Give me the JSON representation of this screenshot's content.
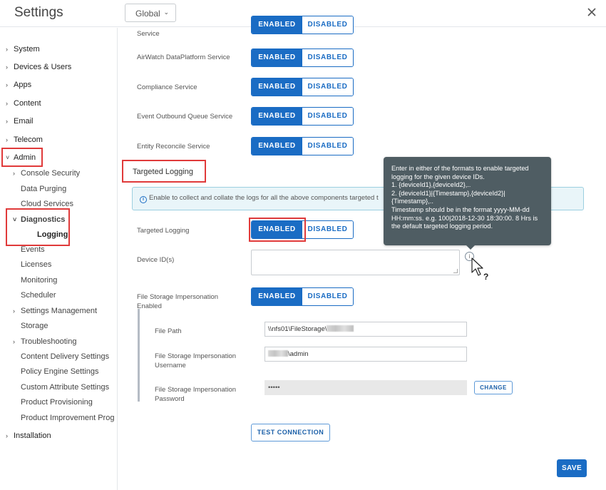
{
  "header": {
    "title": "Settings",
    "scope_select": {
      "value": "Global",
      "icon": "chevron-down-icon"
    },
    "close_icon": "close-icon"
  },
  "sidebar": {
    "items": [
      {
        "label": "System",
        "level": 0,
        "arrow": "›"
      },
      {
        "label": "Devices & Users",
        "level": 0,
        "arrow": "›"
      },
      {
        "label": "Apps",
        "level": 0,
        "arrow": "›"
      },
      {
        "label": "Content",
        "level": 0,
        "arrow": "›"
      },
      {
        "label": "Email",
        "level": 0,
        "arrow": "›"
      },
      {
        "label": "Telecom",
        "level": 0,
        "arrow": "›"
      },
      {
        "label": "Admin",
        "level": 0,
        "arrow": "⌄",
        "expanded": true,
        "highlighted": true
      },
      {
        "label": "Console Security",
        "level": 1,
        "arrow": "›"
      },
      {
        "label": "Data Purging",
        "level": 1
      },
      {
        "label": "Cloud Services",
        "level": 1
      },
      {
        "label": "Diagnostics",
        "level": 1,
        "arrow": "⌄",
        "expanded": true,
        "highlighted": true
      },
      {
        "label": "Logging",
        "level": 2,
        "selected": true,
        "highlighted": true
      },
      {
        "label": "Events",
        "level": 1
      },
      {
        "label": "Licenses",
        "level": 1
      },
      {
        "label": "Monitoring",
        "level": 1
      },
      {
        "label": "Scheduler",
        "level": 1
      },
      {
        "label": "Settings Management",
        "level": 1,
        "arrow": "›"
      },
      {
        "label": "Storage",
        "level": 1
      },
      {
        "label": "Troubleshooting",
        "level": 1,
        "arrow": "›"
      },
      {
        "label": "Content Delivery Settings",
        "level": 1
      },
      {
        "label": "Policy Engine Settings",
        "level": 1
      },
      {
        "label": "Custom Attribute Settings",
        "level": 1
      },
      {
        "label": "Product Provisioning",
        "level": 1
      },
      {
        "label": "Product Improvement Prog",
        "level": 1
      },
      {
        "label": "Installation",
        "level": 0,
        "arrow": "›"
      }
    ]
  },
  "toggle_labels": {
    "enabled": "ENABLED",
    "disabled": "DISABLED"
  },
  "services": [
    {
      "label": "Service",
      "value": "ENABLED"
    },
    {
      "label": "AirWatch DataPlatform Service",
      "value": "ENABLED"
    },
    {
      "label": "Compliance Service",
      "value": "ENABLED"
    },
    {
      "label": "Event Outbound Queue Service",
      "value": "ENABLED"
    },
    {
      "label": "Entity Reconcile Service",
      "value": "ENABLED"
    }
  ],
  "targeted_logging": {
    "section_title": "Targeted Logging",
    "info_text": "Enable to collect and collate the logs for all the above components targeted t",
    "toggle_label": "Targeted Logging",
    "toggle_value": "ENABLED",
    "device_ids_label": "Device ID(s)",
    "device_ids_value": "",
    "help_icon": "info-icon"
  },
  "tooltip": {
    "lines": [
      "Enter in either of the formats to enable targeted",
      "logging for the given device IDs.",
      "1. {deviceId1},{deviceId2},..",
      "2. {deviceId1}|{Timestamp},{deviceId2}|",
      "{Timestamp},..",
      "Timestamp should be in the format yyyy-MM-dd",
      "HH:mm:ss. e.g. 100|2018-12-30 18:30:00. 8 Hrs is",
      "the default targeted logging period."
    ]
  },
  "file_storage": {
    "impersonation_label_1": "File Storage Impersonation",
    "impersonation_label_2": "Enabled",
    "impersonation_value": "ENABLED",
    "file_path_label": "File Path",
    "file_path_value": "\\\\nfs01\\FileStorage\\",
    "username_label_1": "File Storage Impersonation",
    "username_label_2": "Username",
    "username_value": "\\admin",
    "password_label_1": "File Storage Impersonation",
    "password_label_2": "Password",
    "password_value": "•••••",
    "change_button": "CHANGE",
    "test_connection_button": "TEST CONNECTION"
  },
  "footer": {
    "save_button": "SAVE"
  },
  "colors": {
    "accent": "#1a6cc4",
    "highlight": "#e03a3a",
    "tooltip_bg": "#4f5d63",
    "info_bg": "#e9f5f9"
  }
}
